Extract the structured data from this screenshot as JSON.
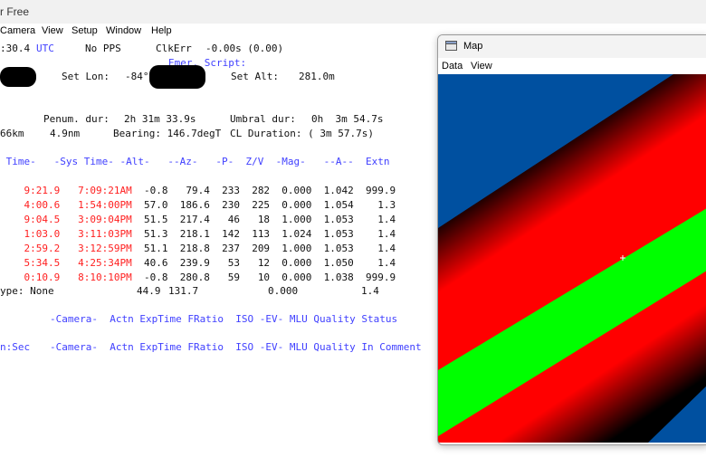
{
  "app": {
    "title": "r Free"
  },
  "menu": [
    "Camera",
    "View",
    "Setup",
    "Window",
    "Help"
  ],
  "status": {
    "time": ":30.4",
    "tz": "UTC",
    "pps": "No PPS",
    "clkerr_label": "ClkErr",
    "clkerr_value": "-0.00s (0.00)",
    "emer_script": "Emer. Script:"
  },
  "location": {
    "set_lon_label": "Set Lon:",
    "set_lon_value": "-84°",
    "set_alt_label": "Set Alt:",
    "set_alt_value": "281.0m"
  },
  "durations": {
    "penum_label": "Penum. dur:",
    "penum_value": "2h 31m 33.9s",
    "umbral_label": "Umbral dur:",
    "umbral_value": "0h  3m 54.7s"
  },
  "path": {
    "width_partial": "66km",
    "distance": "4.9nm",
    "bearing": "Bearing: 146.7degT",
    "cl_duration": "CL Duration: ( 3m 57.7s)"
  },
  "table": {
    "header": " Time-   -Sys Time- -Alt-   --Az-   -P-  Z/V  -Mag-   --A--  Extn",
    "rows": [
      {
        "time": "9:21.9",
        "sys": "7:09:21AM ",
        "rest": "-0.8   79.4  233  282  0.000  1.042  999.9"
      },
      {
        "time": "4:00.6",
        "sys": "1:54:00PM ",
        "rest": "57.0  186.6  230  225  0.000  1.054    1.3"
      },
      {
        "time": "9:04.5",
        "sys": "3:09:04PM ",
        "rest": "51.5  217.4   46   18  1.000  1.053    1.4"
      },
      {
        "time": "1:03.0",
        "sys": "3:11:03PM ",
        "rest": "51.3  218.1  142  113  1.024  1.053    1.4"
      },
      {
        "time": "2:59.2",
        "sys": "3:12:59PM ",
        "rest": "51.1  218.8  237  209  1.000  1.053    1.4"
      },
      {
        "time": "5:34.5",
        "sys": "4:25:34PM ",
        "rest": "40.6  239.9   53   12  0.000  1.050    1.4"
      },
      {
        "time": "0:10.9",
        "sys": "8:10:10PM ",
        "rest": "-0.8  280.8   59   10  0.000  1.038  999.9"
      }
    ]
  },
  "type_line": {
    "label": "ype: None",
    "alt": "44.9",
    "az": "131.7",
    "mag": "0.000",
    "extn": "1.4"
  },
  "camera_header_1": "-Camera-  Actn ExpTime FRatio  ISO -EV- MLU Quality Status",
  "camera_header_2_prefix": "n:Sec",
  "camera_header_2": "-Camera-  Actn ExpTime FRatio  ISO -EV- MLU Quality In Comment",
  "map_window": {
    "title": "Map",
    "menu": [
      "Data",
      "View"
    ],
    "colors": {
      "ocean": "#0050a0",
      "penumbra": "#ff0000",
      "umbra": "#00ff00"
    }
  }
}
